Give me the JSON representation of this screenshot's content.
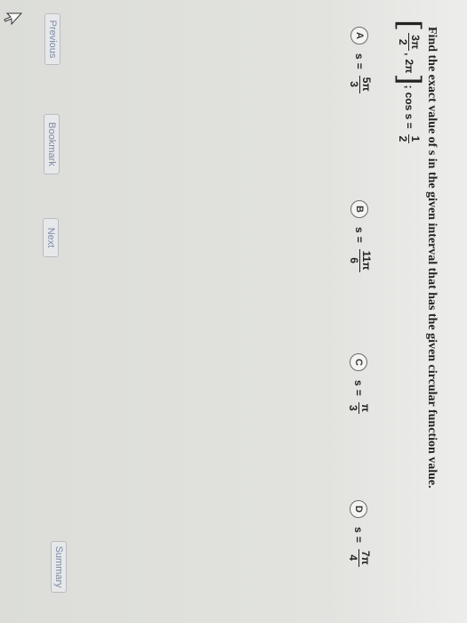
{
  "question": {
    "text": "Find the exact value of s in the given interval that has the given circular function value.",
    "interval": {
      "open_bracket": "[",
      "lower_num": "3π",
      "lower_den": "2",
      "separator": ",",
      "upper": "2π",
      "close_bracket": "]",
      "semicolon": ";",
      "function": "cos s =",
      "value_num": "1",
      "value_den": "2"
    }
  },
  "choices": [
    {
      "letter": "A",
      "var": "s",
      "eq": "=",
      "num": "5π",
      "den": "3"
    },
    {
      "letter": "B",
      "var": "s",
      "eq": "=",
      "num": "11π",
      "den": "6"
    },
    {
      "letter": "C",
      "var": "s",
      "eq": "=",
      "num": "π",
      "den": "3"
    },
    {
      "letter": "D",
      "var": "s",
      "eq": "=",
      "num": "7π",
      "den": "4"
    }
  ],
  "buttons": {
    "previous": "Previous",
    "bookmark": "Bookmark",
    "next": "Next",
    "summary": "Summary"
  }
}
